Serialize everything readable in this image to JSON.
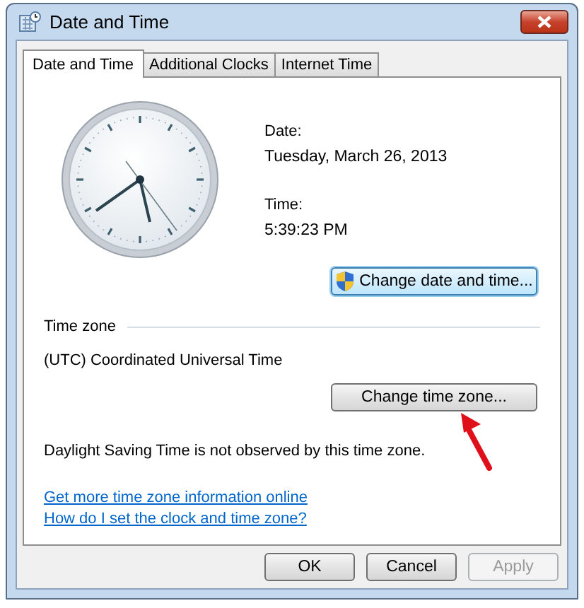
{
  "window": {
    "title": "Date and Time"
  },
  "tabs": [
    {
      "label": "Date and Time",
      "selected": true
    },
    {
      "label": "Additional Clocks",
      "selected": false
    },
    {
      "label": "Internet Time",
      "selected": false
    }
  ],
  "date": {
    "label": "Date:",
    "value": "Tuesday, March 26, 2013"
  },
  "time": {
    "label": "Time:",
    "value": "5:39:23 PM"
  },
  "change_date_button": {
    "label": "Change date and time...",
    "kind": "shield",
    "disabled": false
  },
  "time_zone": {
    "heading": "Time zone",
    "value": "(UTC) Coordinated Universal Time"
  },
  "change_zone_button": {
    "label": "Change time zone...",
    "disabled": false
  },
  "dst_note": "Daylight Saving Time is not observed by this time zone.",
  "links": [
    "Get more time zone information online",
    "How do I set the clock and time zone?"
  ],
  "buttons": [
    {
      "label": "OK",
      "disabled": false
    },
    {
      "label": "Cancel",
      "disabled": false
    },
    {
      "label": "Apply",
      "disabled": true
    }
  ]
}
